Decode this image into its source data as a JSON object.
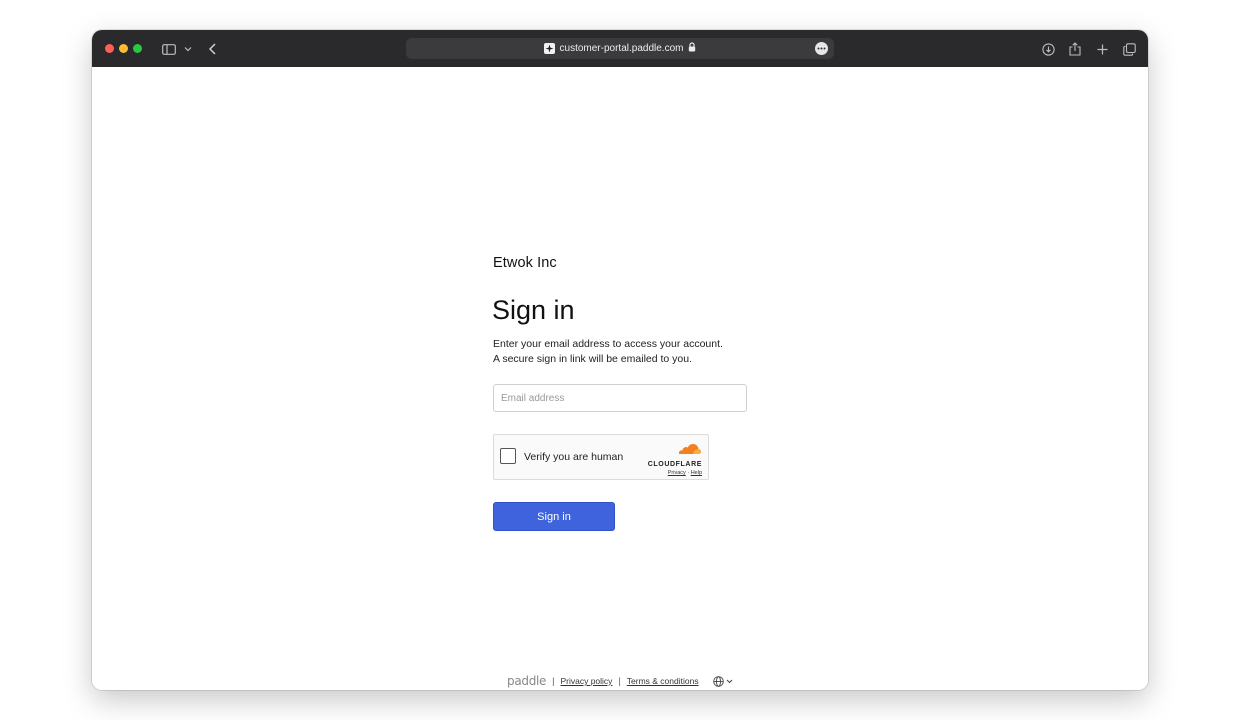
{
  "browser": {
    "url": "customer-portal.paddle.com"
  },
  "page": {
    "company_name": "Etwok Inc",
    "heading": "Sign in",
    "description_line1": "Enter your email address to access your account.",
    "description_line2": "A secure sign in link will be emailed to you.",
    "email_placeholder": "Email address",
    "email_value": "",
    "captcha": {
      "label": "Verify you are human",
      "provider": "CLOUDFLARE",
      "privacy": "Privacy",
      "help": "Help",
      "separator": "·"
    },
    "signin_button": "Sign in"
  },
  "footer": {
    "brand": "paddle",
    "separator": "|",
    "privacy_policy": "Privacy policy",
    "terms": "Terms & conditions"
  },
  "colors": {
    "primary": "#3f63dd",
    "cloudflare_orange": "#f38020",
    "titlebar": "#2a2a2c"
  },
  "icons": [
    "sidebar-toggle-icon",
    "chevron-down-icon",
    "back-arrow-icon",
    "favicon-sparkle-icon",
    "lock-icon",
    "more-icon",
    "download-icon",
    "share-icon",
    "new-tab-plus-icon",
    "tabs-overview-icon",
    "globe-icon"
  ]
}
